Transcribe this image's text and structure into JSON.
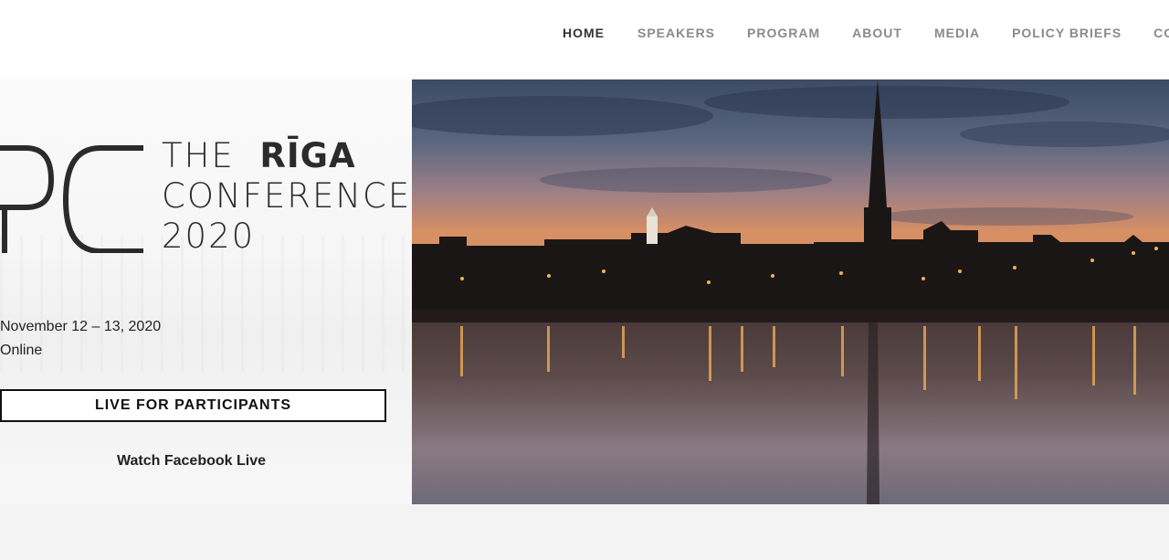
{
  "nav": {
    "items": [
      {
        "label": "HOME",
        "active": true
      },
      {
        "label": "SPEAKERS",
        "active": false
      },
      {
        "label": "PROGRAM",
        "active": false
      },
      {
        "label": "ABOUT",
        "active": false
      },
      {
        "label": "MEDIA",
        "active": false
      },
      {
        "label": "POLICY BRIEFS",
        "active": false
      },
      {
        "label": "CONTACT",
        "active": false
      }
    ]
  },
  "hero": {
    "logo": {
      "line1_prefix": "THE",
      "line1_bold": "RĪGA",
      "line2": "CONFERENCE",
      "line3": "2020"
    },
    "date": "November 12 – 13, 2020",
    "location": "Online",
    "live_button": "LIVE FOR PARTICIPANTS",
    "facebook_link": "Watch Facebook Live",
    "image_alt": "riga-skyline-dusk-photo"
  },
  "colors": {
    "accent_dark": "#111111",
    "nav_inactive": "#8a8a8a",
    "nav_active": "#333333"
  }
}
